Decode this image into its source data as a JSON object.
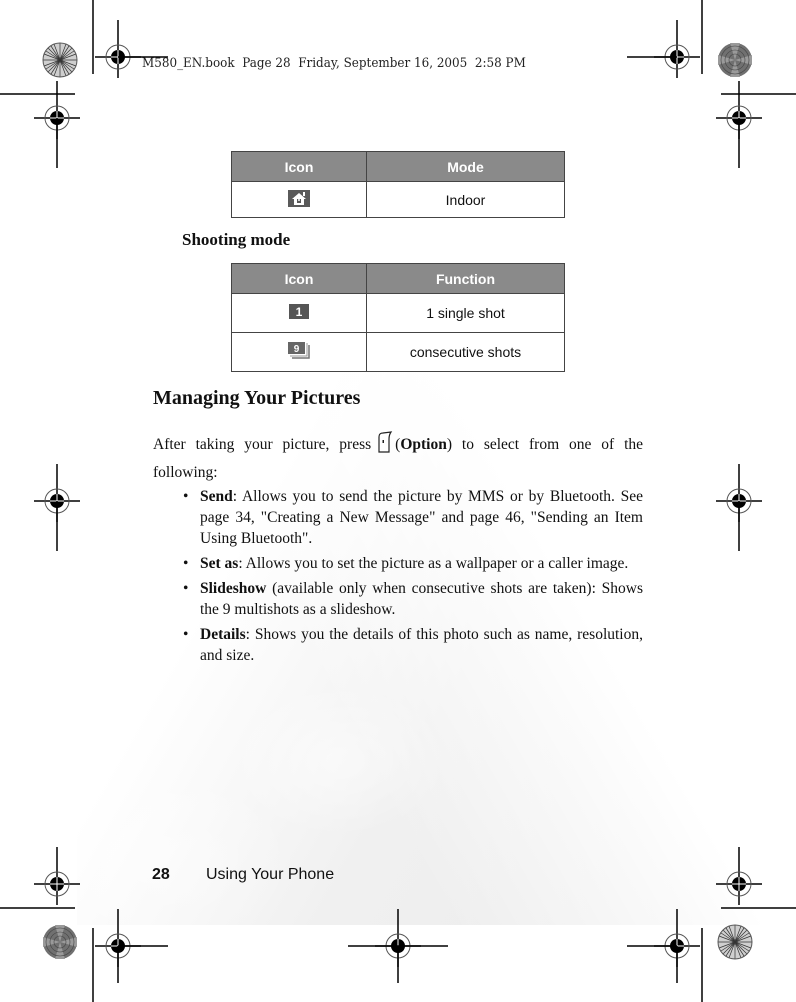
{
  "print_header": "M580_EN.book  Page 28  Friday, September 16, 2005  2:58 PM",
  "mode_table": {
    "headers": [
      "Icon",
      "Mode"
    ],
    "rows": [
      {
        "icon": "indoor-house-icon",
        "label": "Indoor"
      }
    ]
  },
  "shooting_mode": {
    "title": "Shooting mode",
    "headers": [
      "Icon",
      "Function"
    ],
    "rows": [
      {
        "icon": "single-shot-1-icon",
        "label": "1 single shot"
      },
      {
        "icon": "consecutive-shots-9-icon",
        "label": "consecutive shots"
      }
    ]
  },
  "managing": {
    "title": "Managing Your Pictures",
    "intro_before": "After taking your picture, press",
    "key_icon": "left-soft-key-icon",
    "intro_option": "Option",
    "intro_after": ") to select from one of the following:",
    "intro_paren": "(",
    "bullets": [
      {
        "term": "Send",
        "sep": ":",
        "text": " Allows you to send the picture by MMS or by Bluetooth. See page 34, \"Creating a New Message\" and page 46, \"Sending an Item Using Bluetooth\"."
      },
      {
        "term": "Set as",
        "sep": ":",
        "text": " Allows you to set the picture as a wallpaper or a caller image."
      },
      {
        "term": "Slideshow",
        "sep": "",
        "text": " (available only when consecutive shots are taken): Shows the 9 multishots as a slideshow."
      },
      {
        "term": "Details",
        "sep": ":",
        "text": " Shows you the details of this photo such as name, resolution, and size."
      }
    ],
    "bullet_char": "•"
  },
  "footer": {
    "page_number": "28",
    "chapter": "Using Your Phone"
  }
}
